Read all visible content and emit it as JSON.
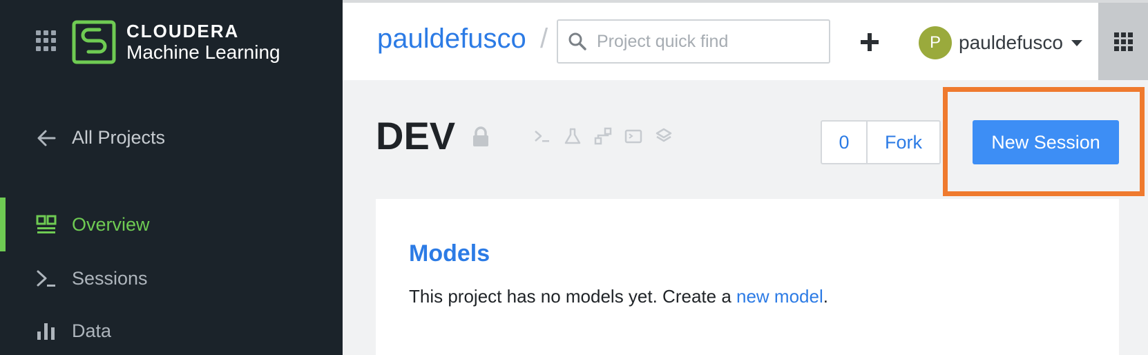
{
  "brand": {
    "name": "CLOUDERA",
    "product": "Machine Learning",
    "accent_color": "#6fcb53"
  },
  "sidebar": {
    "back_label": "All Projects",
    "items": [
      {
        "label": "Overview",
        "icon": "overview-icon",
        "active": true
      },
      {
        "label": "Sessions",
        "icon": "terminal-icon",
        "active": false
      },
      {
        "label": "Data",
        "icon": "bar-chart-icon",
        "active": false
      }
    ]
  },
  "header": {
    "breadcrumb_user": "pauldefusco",
    "breadcrumb_separator": "/",
    "search_placeholder": "Project quick find",
    "search_value": "",
    "user": {
      "initial": "P",
      "name": "pauldefusco",
      "avatar_color": "#9aaa3c"
    }
  },
  "project": {
    "title": "DEV",
    "fork_count": "0",
    "fork_label": "Fork",
    "new_session_label": "New Session",
    "highlight_color": "#ef7a2e",
    "tool_icons": [
      "terminal-icon",
      "flask-icon",
      "workflow-icon",
      "console-icon",
      "layers-icon"
    ]
  },
  "models": {
    "title": "Models",
    "text_before": "This project has no models yet. Create a ",
    "link": "new model",
    "text_after": "."
  }
}
